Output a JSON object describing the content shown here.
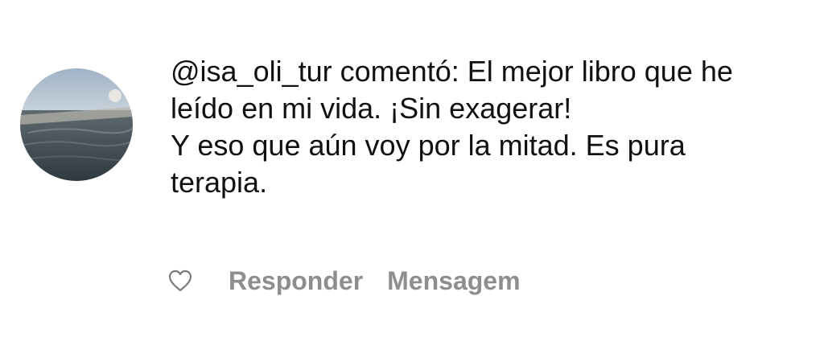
{
  "comment": {
    "lines": [
      "@isa_oli_tur comentó: El mejor libro que he",
      "leído en mi vida. ¡Sin exagerar!",
      "Y eso que aún voy por la mitad. Es pura",
      "terapia."
    ]
  },
  "avatar": {
    "icon": "profile-photo-beach"
  },
  "actions": {
    "like_icon": "heart-outline-icon",
    "reply_label": "Responder",
    "message_label": "Mensagem"
  },
  "colors": {
    "text": "#111111",
    "muted": "#8e8e8e",
    "background": "#ffffff"
  }
}
